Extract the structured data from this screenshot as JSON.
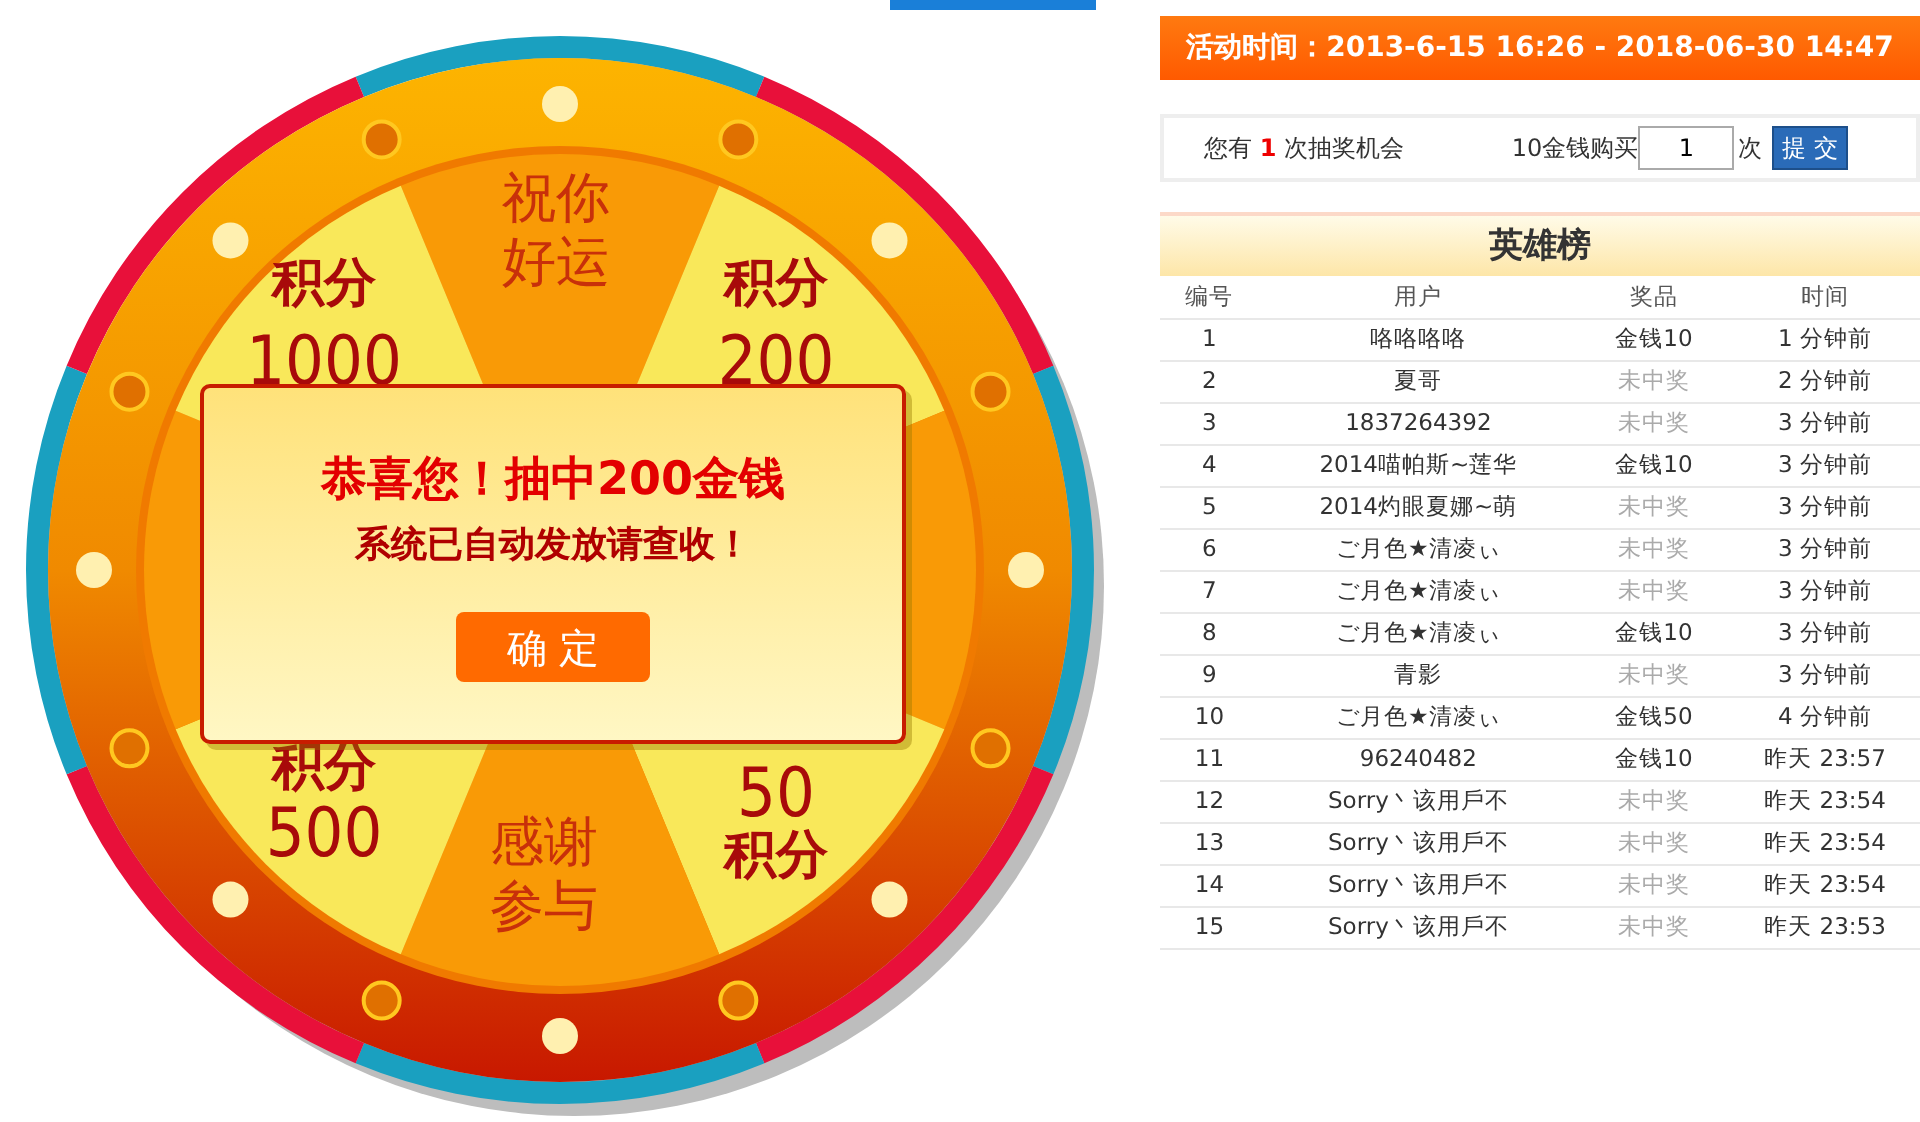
{
  "wheel": {
    "segments": [
      {
        "kind": "message",
        "lines": [
          {
            "text": "祝你",
            "kind": "plain"
          },
          {
            "text": "好运",
            "kind": "plain"
          }
        ]
      },
      {
        "kind": "points",
        "lines": [
          {
            "text": "积分",
            "kind": "script"
          },
          {
            "text": "200",
            "kind": "number"
          }
        ]
      },
      {
        "kind": "message"
      },
      {
        "kind": "points",
        "lines": [
          {
            "text": "50",
            "kind": "number"
          },
          {
            "text": "积分",
            "kind": "script"
          }
        ]
      },
      {
        "kind": "message",
        "lines": [
          {
            "text": "感谢",
            "kind": "plain"
          },
          {
            "text": "参与",
            "kind": "plain"
          }
        ]
      },
      {
        "kind": "points",
        "lines": [
          {
            "text": "积分",
            "kind": "script"
          },
          {
            "text": "500",
            "kind": "number"
          }
        ]
      },
      {
        "kind": "message"
      },
      {
        "kind": "points",
        "lines": [
          {
            "text": "积分",
            "kind": "script"
          },
          {
            "text": "1000",
            "kind": "number"
          }
        ]
      }
    ]
  },
  "dialog": {
    "title": "恭喜您！抽中200金钱",
    "message": "系统已自动发放请查收！",
    "button": "确 定"
  },
  "activity_time": "活动时间：2013-6-15 16:26 - 2018-06-30 14:47",
  "chances": "您有 **1** 次抽奖机会",
  "buy": {
    "label": "10金钱购买",
    "value": "1",
    "unit": "次",
    "button": "提 交"
  },
  "leaderboard": {
    "title": "英雄榜",
    "columns": [
      "编号",
      "用户",
      "奖品",
      "时间"
    ],
    "rows": [
      {
        "cells": [
          "1",
          "咯咯咯咯",
          "金钱10",
          "1 分钟前"
        ],
        "won": true
      },
      {
        "cells": [
          "2",
          "夏哥",
          "未中奖",
          "2 分钟前"
        ],
        "won": false
      },
      {
        "cells": [
          "3",
          "1837264392",
          "未中奖",
          "3 分钟前"
        ],
        "won": false
      },
      {
        "cells": [
          "4",
          "2014喵帕斯~莲华",
          "金钱10",
          "3 分钟前"
        ],
        "won": true
      },
      {
        "cells": [
          "5",
          "2014灼眼夏娜~萌",
          "未中奖",
          "3 分钟前"
        ],
        "won": false
      },
      {
        "cells": [
          "6",
          "ご月色★清凌ぃ",
          "未中奖",
          "3 分钟前"
        ],
        "won": false
      },
      {
        "cells": [
          "7",
          "ご月色★清凌ぃ",
          "未中奖",
          "3 分钟前"
        ],
        "won": false
      },
      {
        "cells": [
          "8",
          "ご月色★清凌ぃ",
          "金钱10",
          "3 分钟前"
        ],
        "won": true
      },
      {
        "cells": [
          "9",
          "青影",
          "未中奖",
          "3 分钟前"
        ],
        "won": false
      },
      {
        "cells": [
          "10",
          "ご月色★清凌ぃ",
          "金钱50",
          "4 分钟前"
        ],
        "won": true
      },
      {
        "cells": [
          "11",
          "96240482",
          "金钱10",
          "昨天 23:57"
        ],
        "won": true
      },
      {
        "cells": [
          "12",
          "Sorry丶该用戶不",
          "未中奖",
          "昨天 23:54"
        ],
        "won": false
      },
      {
        "cells": [
          "13",
          "Sorry丶该用戶不",
          "未中奖",
          "昨天 23:54"
        ],
        "won": false
      },
      {
        "cells": [
          "14",
          "Sorry丶该用戶不",
          "未中奖",
          "昨天 23:54"
        ],
        "won": false
      },
      {
        "cells": [
          "15",
          "Sorry丶该用戶不",
          "未中奖",
          "昨天 23:53"
        ],
        "won": false
      }
    ]
  }
}
